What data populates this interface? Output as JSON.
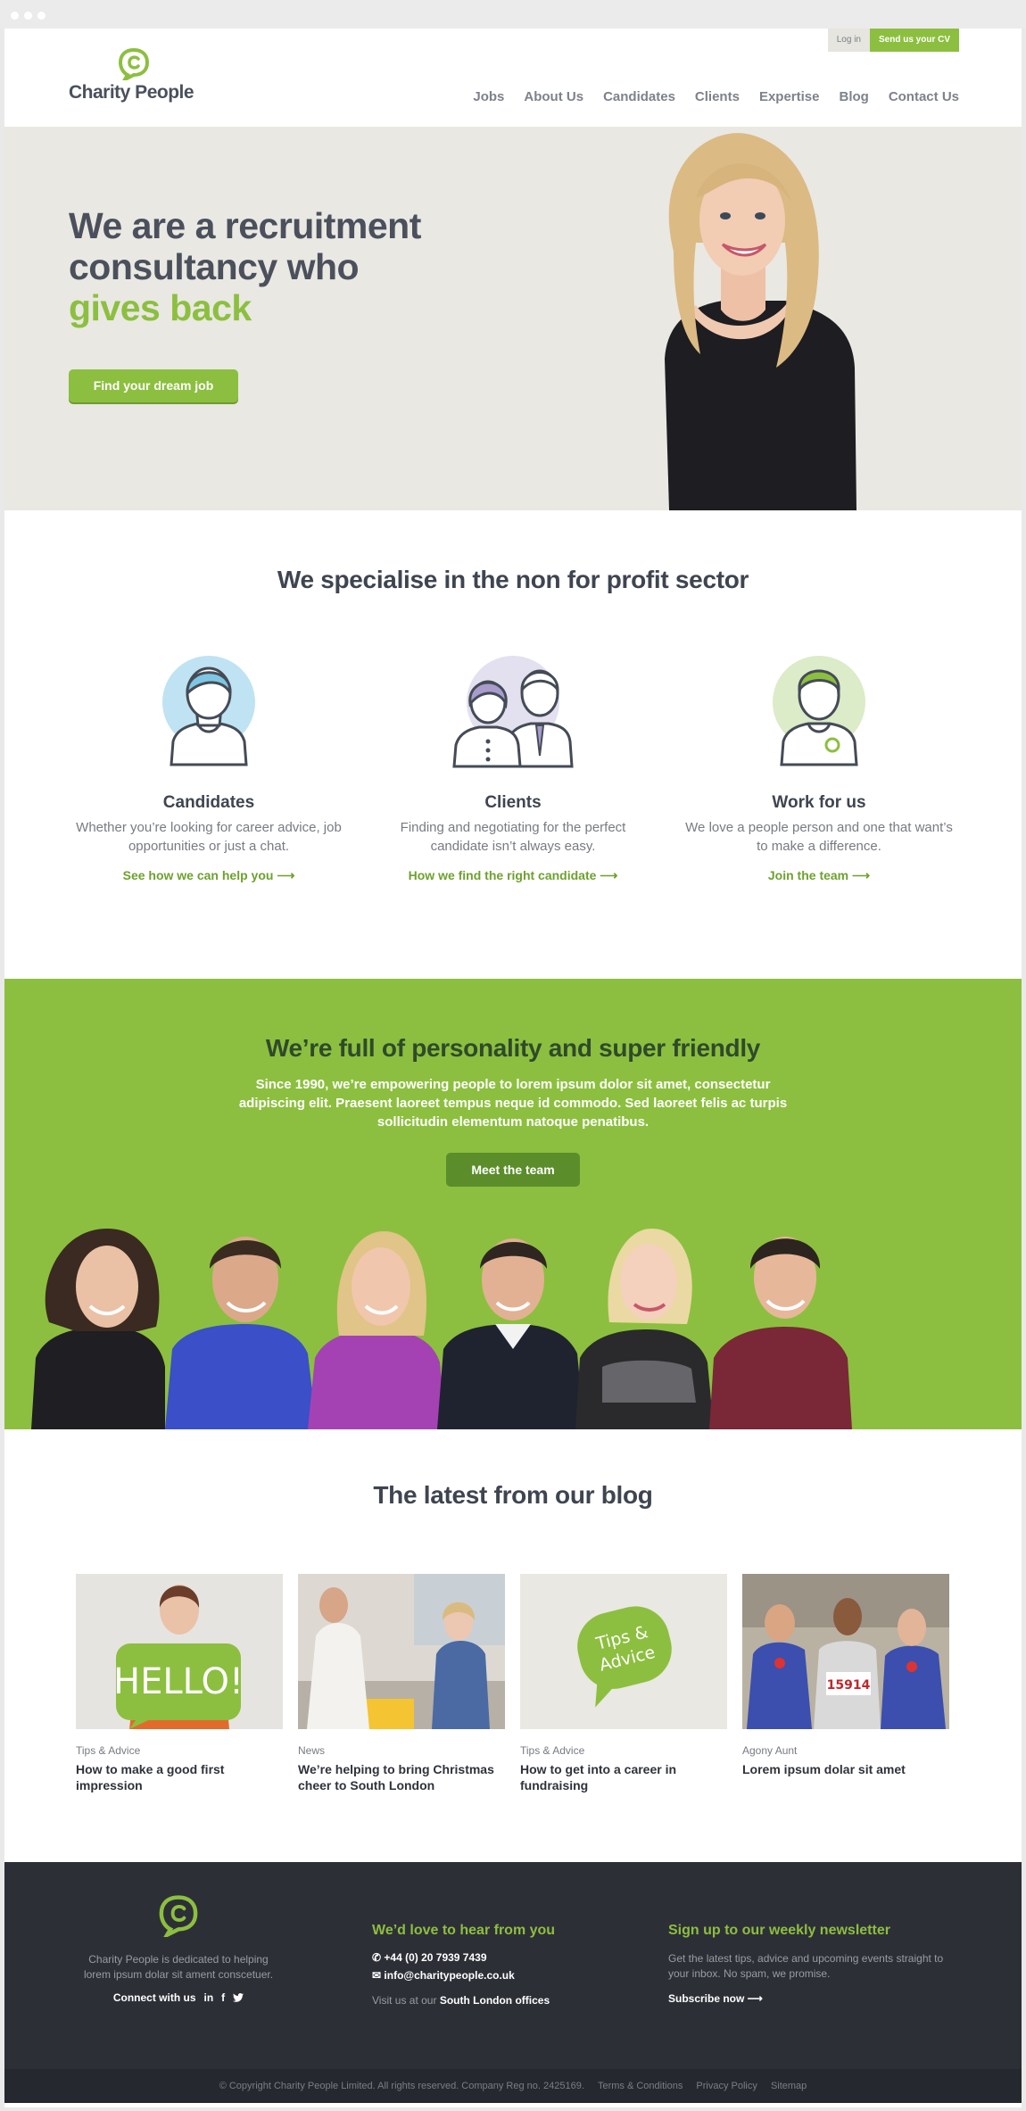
{
  "brand": {
    "name": "Charity People",
    "accent": "#8cbf3f",
    "dark": "#2d2f37"
  },
  "header": {
    "login_label": "Log in",
    "cv_label": "Send us your CV",
    "nav": [
      "Jobs",
      "About Us",
      "Candidates",
      "Clients",
      "Expertise",
      "Blog",
      "Contact Us"
    ]
  },
  "hero": {
    "line1": "We are a recruitment",
    "line2": "consultancy who",
    "line3": "gives back",
    "cta": "Find your dream job"
  },
  "specialise": {
    "title": "We specialise in the non for profit sector",
    "cards": [
      {
        "title": "Candidates",
        "text": "Whether you’re looking for career advice, job opportunities or just a chat.",
        "link": "See how we can help you ⟶"
      },
      {
        "title": "Clients",
        "text": "Finding and negotiating for the perfect candidate isn’t always easy.",
        "link": "How we find the right candidate ⟶"
      },
      {
        "title": "Work for us",
        "text": "We love a people person and one that want’s to make a difference.",
        "link": "Join the team ⟶"
      }
    ]
  },
  "personality": {
    "title": "We’re full of personality and super friendly",
    "text": "Since 1990, we’re empowering people to lorem ipsum dolor sit amet, consectetur adipiscing elit. Praesent laoreet tempus neque id commodo. Sed laoreet felis ac turpis sollicitudin elementum natoque penatibus.",
    "cta": "Meet the team"
  },
  "blog": {
    "title": "The latest from our blog",
    "posts": [
      {
        "category": "Tips & Advice",
        "title": "How to make a good first impression",
        "image_text": "HELLO!"
      },
      {
        "category": "News",
        "title": "We’re helping to bring Christmas cheer to South London"
      },
      {
        "category": "Tips & Advice",
        "title": "How to get into a career in fundraising",
        "image_text_1": "Tips &",
        "image_text_2": "Advice"
      },
      {
        "category": "Agony Aunt",
        "title": "Lorem ipsum dolar sit amet",
        "image_text": "15914"
      }
    ]
  },
  "footer": {
    "about": "Charity People is dedicated to helping lorem ipsum dolar sit ament conscetuer.",
    "connect": "Connect with us",
    "contact_title": "We’d love to hear from you",
    "phone": "+44 (0) 20 7939 7439",
    "email": "info@charitypeople.co.uk",
    "visit_prefix": "Visit us at our",
    "visit_link": "South London offices",
    "news_title": "Sign up to our weekly newsletter",
    "news_text": "Get the latest tips, advice and upcoming events straight to your inbox. No spam, we promise.",
    "subscribe": "Subscribe now ⟶",
    "copyright": "© Copyright Charity People Limited. All rights reserved. Company Reg no. 2425169.",
    "links": [
      "Terms & Conditions",
      "Privacy Policy",
      "Sitemap"
    ]
  }
}
